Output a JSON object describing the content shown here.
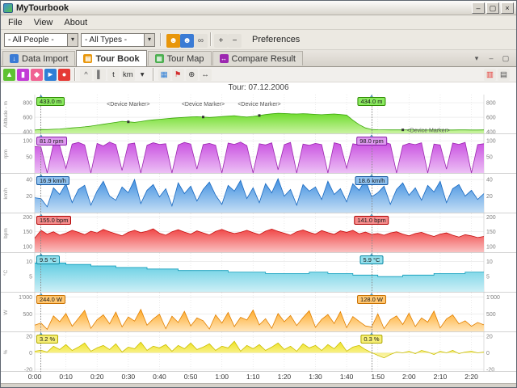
{
  "window": {
    "title": "MyTourbook",
    "buttons": [
      {
        "name": "minimize-button",
        "glyph": "–"
      },
      {
        "name": "maximize-button",
        "glyph": "▢"
      },
      {
        "name": "close-button",
        "glyph": "×"
      }
    ]
  },
  "menu": {
    "items": [
      "File",
      "View",
      "About"
    ]
  },
  "toolbar": {
    "people_combo": "- All People -",
    "types_combo": "- All Types -",
    "combo_arrow": "▾",
    "preferences_label": "Preferences",
    "icons": [
      {
        "name": "filter-person-icon",
        "glyph": "☻",
        "fg": "#ffffff",
        "bg": "#e8960a"
      },
      {
        "name": "filter-people-icon",
        "glyph": "☻",
        "fg": "#ffffff",
        "bg": "#3a7bd5"
      },
      {
        "name": "link-tour-icon",
        "glyph": "∞",
        "fg": "#555555",
        "bg": "#e4e1da"
      },
      {
        "sep": true
      },
      {
        "name": "expand-all-icon",
        "glyph": "+",
        "fg": "#333333",
        "bg": "#e4e1da"
      },
      {
        "name": "collapse-all-icon",
        "glyph": "−",
        "fg": "#333333",
        "bg": "#e4e1da"
      }
    ]
  },
  "tabs": [
    {
      "label": "Data Import",
      "active": false,
      "icon": {
        "name": "data-import-icon",
        "glyph": "↓",
        "bg": "#3a7bd5"
      }
    },
    {
      "label": "Tour Book",
      "active": true,
      "icon": {
        "name": "tour-book-icon",
        "glyph": "▤",
        "bg": "#e8960a"
      }
    },
    {
      "label": "Tour Map",
      "active": false,
      "icon": {
        "name": "tour-map-icon",
        "glyph": "▦",
        "bg": "#4caf50"
      }
    },
    {
      "label": "Compare Result",
      "active": false,
      "icon": {
        "name": "compare-result-icon",
        "glyph": "↔",
        "bg": "#9c27b0"
      }
    }
  ],
  "tabbar_right_icons": [
    {
      "name": "view-menu-icon",
      "glyph": "▾",
      "fg": "#555555",
      "bg": "transparent"
    },
    {
      "name": "minimize-view-icon",
      "glyph": "–",
      "fg": "#555555",
      "bg": "transparent"
    },
    {
      "name": "maximize-view-icon",
      "glyph": "▢",
      "fg": "#555555",
      "bg": "transparent"
    }
  ],
  "chart_toolbar": {
    "left_icons": [
      {
        "name": "graph-altitude-icon",
        "glyph": "▲",
        "fg": "#ffffff",
        "bg": "#5ec232"
      },
      {
        "name": "graph-cadence-icon",
        "glyph": "▮",
        "fg": "#ffffff",
        "bg": "#c23ad6"
      },
      {
        "name": "graph-pace-icon",
        "glyph": "◆",
        "fg": "#ffffff",
        "bg": "#f06292"
      },
      {
        "name": "graph-speed-icon",
        "glyph": "►",
        "fg": "#ffffff",
        "bg": "#2f7fd6"
      },
      {
        "name": "graph-pulse-icon",
        "glyph": "●",
        "fg": "#ffffff",
        "bg": "#e53935"
      },
      {
        "sep": true
      },
      {
        "name": "line-chart-icon",
        "glyph": "^",
        "fg": "#555555",
        "bg": "#eceae5"
      },
      {
        "name": "bar-chart-icon",
        "glyph": "▌",
        "fg": "#777777",
        "bg": "#eceae5"
      },
      {
        "name": "x-axis-time-icon",
        "glyph": "t",
        "fg": "#333333",
        "bg": "#eceae5"
      },
      {
        "name": "x-axis-distance-icon",
        "glyph": "km",
        "fg": "#333333",
        "bg": "#eceae5"
      },
      {
        "name": "chevron-down-icon",
        "glyph": "▾",
        "fg": "#333333",
        "bg": "transparent"
      },
      {
        "sep": true
      },
      {
        "name": "tour-segments-icon",
        "glyph": "▦",
        "fg": "#2f7fd6",
        "bg": "#eceae5"
      },
      {
        "name": "tour-marker-icon",
        "glyph": "⚑",
        "fg": "#d32f2f",
        "bg": "#eceae5"
      },
      {
        "name": "zoom-in-icon",
        "glyph": "⊕",
        "fg": "#333333",
        "bg": "#eceae5"
      },
      {
        "name": "fit-graph-icon",
        "glyph": "↔",
        "fg": "#333333",
        "bg": "#eceae5"
      }
    ],
    "right_icons": [
      {
        "name": "hr-zones-icon",
        "glyph": "▥",
        "fg": "#e53935",
        "bg": "#eceae5"
      },
      {
        "name": "chart-options-icon",
        "glyph": "▤",
        "fg": "#555555",
        "bg": "#eceae5"
      }
    ]
  },
  "chart_data": {
    "type": "area",
    "title": "Tour: 07.12.2006",
    "x_unit": "time",
    "x_step_min": 2,
    "x_total_min": 144,
    "x_tick_interval_min": 10,
    "x_tick_labels": [
      "0:00",
      "0:10",
      "0:20",
      "0:30",
      "0:40",
      "0:50",
      "1:00",
      "1:10",
      "1:20",
      "1:30",
      "1:40",
      "1:50",
      "2:00",
      "2:10",
      "2:20"
    ],
    "sliders": {
      "left": {
        "t": 2
      },
      "right": {
        "t": 108,
        "time_label": "1:50"
      }
    },
    "markers": {
      "label": "<Device Marker>",
      "points": [
        {
          "t": 30,
          "pos": "above"
        },
        {
          "t": 54,
          "pos": "above"
        },
        {
          "t": 72,
          "pos": "above"
        },
        {
          "t": 118,
          "pos": "right"
        }
      ]
    },
    "series": [
      {
        "key": "altitude",
        "axis_label": "Altitude - m",
        "ymin": 380,
        "ymax": 900,
        "baseline": "bottom",
        "step": false,
        "ticks": [
          {
            "v": 400,
            "label": "400"
          },
          {
            "v": 600,
            "label": "600"
          },
          {
            "v": 800,
            "label": "800"
          }
        ],
        "style": {
          "fill_top": "#6fdc2e",
          "fill_bottom": "#c9f3a0",
          "stroke": "#3aa60a",
          "box_bg": "#8ae95f",
          "box_border": "#2e8b00"
        },
        "left_value": "433.0 m",
        "slider_value": "434.0 m",
        "values": [
          425,
          433,
          432,
          436,
          440,
          448,
          455,
          462,
          470,
          480,
          492,
          505,
          518,
          530,
          545,
          538,
          530,
          542,
          556,
          565,
          572,
          580,
          588,
          594,
          600,
          605,
          608,
          604,
          598,
          603,
          610,
          616,
          622,
          610,
          604,
          612,
          625,
          638,
          648,
          655,
          652,
          648,
          645,
          650,
          646,
          640,
          636,
          641,
          645,
          638,
          630,
          560,
          500,
          455,
          434,
          430,
          429,
          428,
          428,
          428,
          428,
          428,
          427,
          427,
          428,
          428,
          427,
          427,
          428,
          428,
          427,
          427,
          428
        ]
      },
      {
        "key": "cadence",
        "axis_label": "rpm",
        "ymin": 0,
        "ymax": 118,
        "baseline": "bottom",
        "step": false,
        "ticks": [
          {
            "v": 50,
            "label": "50"
          },
          {
            "v": 100,
            "label": "100"
          }
        ],
        "style": {
          "fill_top": "#c94fe0",
          "fill_bottom": "#ecc0f5",
          "stroke": "#9c27b0",
          "box_bg": "#dd9aef",
          "box_border": "#8a1fa8"
        },
        "left_value": "81.0 rpm",
        "slider_value": "98.0 rpm",
        "values": [
          82,
          81,
          0,
          91,
          85,
          14,
          90,
          95,
          87,
          0,
          92,
          84,
          96,
          88,
          8,
          90,
          93,
          0,
          86,
          94,
          89,
          91,
          0,
          87,
          95,
          90,
          12,
          88,
          92,
          86,
          0,
          93,
          89,
          96,
          85,
          0,
          91,
          87,
          94,
          10,
          88,
          95,
          0,
          90,
          86,
          92,
          88,
          0,
          94,
          89,
          15,
          91,
          87,
          93,
          98,
          88,
          96,
          90,
          0,
          85,
          92,
          88,
          94,
          0,
          90,
          87,
          12,
          93,
          89,
          95,
          0,
          88,
          91
        ]
      },
      {
        "key": "speed",
        "axis_label": "km/h",
        "ymin": 0,
        "ymax": 46,
        "baseline": "bottom",
        "step": false,
        "ticks": [
          {
            "v": 20,
            "label": "20"
          },
          {
            "v": 40,
            "label": "40"
          }
        ],
        "style": {
          "fill_top": "#3f8fe0",
          "fill_bottom": "#c4def5",
          "stroke": "#1768c0",
          "box_bg": "#8fc1ef",
          "box_border": "#1155a0"
        },
        "left_value": "16.9 km/h",
        "slider_value": "18.6 km/h",
        "values": [
          18,
          17,
          7,
          30,
          22,
          35,
          12,
          28,
          33,
          9,
          26,
          38,
          20,
          15,
          31,
          24,
          40,
          11,
          27,
          34,
          19,
          29,
          8,
          36,
          23,
          32,
          14,
          28,
          37,
          21,
          10,
          33,
          26,
          39,
          17,
          30,
          12,
          35,
          24,
          41,
          20,
          28,
          9,
          34,
          26,
          31,
          16,
          38,
          22,
          29,
          13,
          35,
          27,
          40,
          19,
          24,
          32,
          10,
          28,
          36,
          21,
          30,
          15,
          33,
          25,
          38,
          12,
          29,
          34,
          20,
          27,
          16,
          23
        ]
      },
      {
        "key": "pulse",
        "axis_label": "bpm",
        "ymin": 80,
        "ymax": 210,
        "baseline": "bottom",
        "step": false,
        "ticks": [
          {
            "v": 100,
            "label": "100"
          },
          {
            "v": 150,
            "label": "150"
          },
          {
            "v": 200,
            "label": "200"
          }
        ],
        "style": {
          "fill_top": "#f04545",
          "fill_bottom": "#fac0c0",
          "stroke": "#c41010",
          "box_bg": "#f58b8b",
          "box_border": "#b00000"
        },
        "left_value": "155.0 bpm",
        "slider_value": "141.0 bpm",
        "values": [
          128,
          155,
          142,
          150,
          138,
          145,
          155,
          148,
          140,
          152,
          146,
          158,
          150,
          143,
          136,
          148,
          155,
          147,
          152,
          160,
          145,
          138,
          150,
          157,
          149,
          142,
          153,
          146,
          139,
          151,
          158,
          150,
          144,
          148,
          155,
          147,
          140,
          152,
          159,
          151,
          145,
          138,
          150,
          156,
          148,
          142,
          154,
          147,
          141,
          153,
          148,
          155,
          143,
          149,
          141,
          144,
          138,
          146,
          150,
          142,
          136,
          144,
          148,
          140,
          134,
          142,
          146,
          138,
          132,
          140,
          136,
          130,
          134
        ]
      },
      {
        "key": "temperature",
        "axis_label": "°C",
        "ymin": 0,
        "ymax": 12.5,
        "baseline": "bottom",
        "step": true,
        "ticks": [
          {
            "v": 5,
            "label": "5"
          },
          {
            "v": 10,
            "label": "10"
          }
        ],
        "style": {
          "fill_top": "#62cde2",
          "fill_bottom": "#cdeff6",
          "stroke": "#0e9cba",
          "box_bg": "#93dfec",
          "box_border": "#0b8aa5"
        },
        "left_value": "9.5 °C",
        "slider_value": "5.9 °C",
        "values": [
          9.5,
          9.5,
          9.5,
          9.5,
          9.5,
          9.0,
          9.0,
          9.0,
          9.0,
          8.5,
          8.5,
          8.5,
          8.5,
          8.0,
          8.0,
          8.0,
          8.0,
          8.0,
          7.5,
          7.5,
          7.5,
          7.5,
          7.5,
          7.0,
          7.0,
          7.0,
          7.0,
          7.0,
          7.0,
          7.0,
          7.0,
          6.5,
          6.5,
          6.5,
          6.5,
          6.5,
          6.5,
          6.0,
          6.0,
          6.0,
          6.0,
          6.0,
          6.0,
          6.0,
          6.5,
          6.5,
          6.5,
          6.0,
          6.0,
          6.0,
          6.0,
          5.5,
          5.5,
          5.5,
          5.5,
          5.0,
          5.0,
          5.0,
          5.0,
          5.5,
          5.5,
          5.5,
          5.5,
          5.5,
          6.0,
          6.0,
          6.0,
          6.0,
          6.0,
          6.5,
          6.5,
          6.5,
          6.5
        ]
      },
      {
        "key": "power",
        "axis_label": "W",
        "ymin": 0,
        "ymax": 1100,
        "baseline": "bottom",
        "step": false,
        "ticks": [
          {
            "v": 500,
            "label": "500"
          },
          {
            "v": 1000,
            "label": "1'000"
          }
        ],
        "style": {
          "fill_top": "#ffaa28",
          "fill_bottom": "#ffe6bb",
          "stroke": "#e07f00",
          "box_bg": "#ffc670",
          "box_border": "#c87000"
        },
        "left_value": "244.0 W",
        "slider_value": "128.0 W",
        "values": [
          180,
          244,
          60,
          450,
          280,
          520,
          150,
          380,
          610,
          90,
          340,
          480,
          220,
          560,
          130,
          420,
          300,
          640,
          180,
          360,
          500,
          80,
          440,
          260,
          580,
          160,
          390,
          310,
          70,
          480,
          240,
          550,
          140,
          410,
          330,
          620,
          190,
          370,
          90,
          520,
          280,
          460,
          170,
          400,
          600,
          120,
          350,
          490,
          230,
          570,
          110,
          430,
          290,
          160,
          128,
          510,
          80,
          340,
          450,
          200,
          530,
          140,
          390,
          270,
          590,
          100,
          360,
          480,
          220,
          310,
          150,
          260,
          190
        ]
      },
      {
        "key": "gradient",
        "axis_label": "%",
        "ymin": -22,
        "ymax": 24,
        "baseline": "zero",
        "step": false,
        "ticks": [
          {
            "v": 20,
            "label": "20"
          },
          {
            "v": 0,
            "label": "0"
          },
          {
            "v": -20,
            "label": "-20"
          }
        ],
        "style": {
          "fill_top": "#f0e31f",
          "fill_bottom": "#fbf6b8",
          "stroke": "#c9bd00",
          "box_bg": "#f6ee76",
          "box_border": "#b0a800"
        },
        "left_value": "3.2 %",
        "slider_value": "0.3 %",
        "values": [
          2,
          3.2,
          1,
          8,
          4,
          10,
          3,
          7,
          12,
          2,
          6,
          9,
          4,
          11,
          1,
          7,
          5,
          13,
          3,
          8,
          6,
          10,
          2,
          9,
          5,
          12,
          4,
          7,
          11,
          3,
          8,
          6,
          14,
          2,
          9,
          5,
          10,
          3,
          7,
          12,
          4,
          8,
          2,
          11,
          6,
          9,
          3,
          10,
          5,
          13,
          2,
          7,
          9,
          4,
          0.3,
          -3,
          -6,
          -2,
          1,
          0,
          2,
          -1,
          3,
          1,
          -2,
          2,
          0,
          3,
          -1,
          1,
          2,
          0,
          1
        ]
      }
    ]
  }
}
